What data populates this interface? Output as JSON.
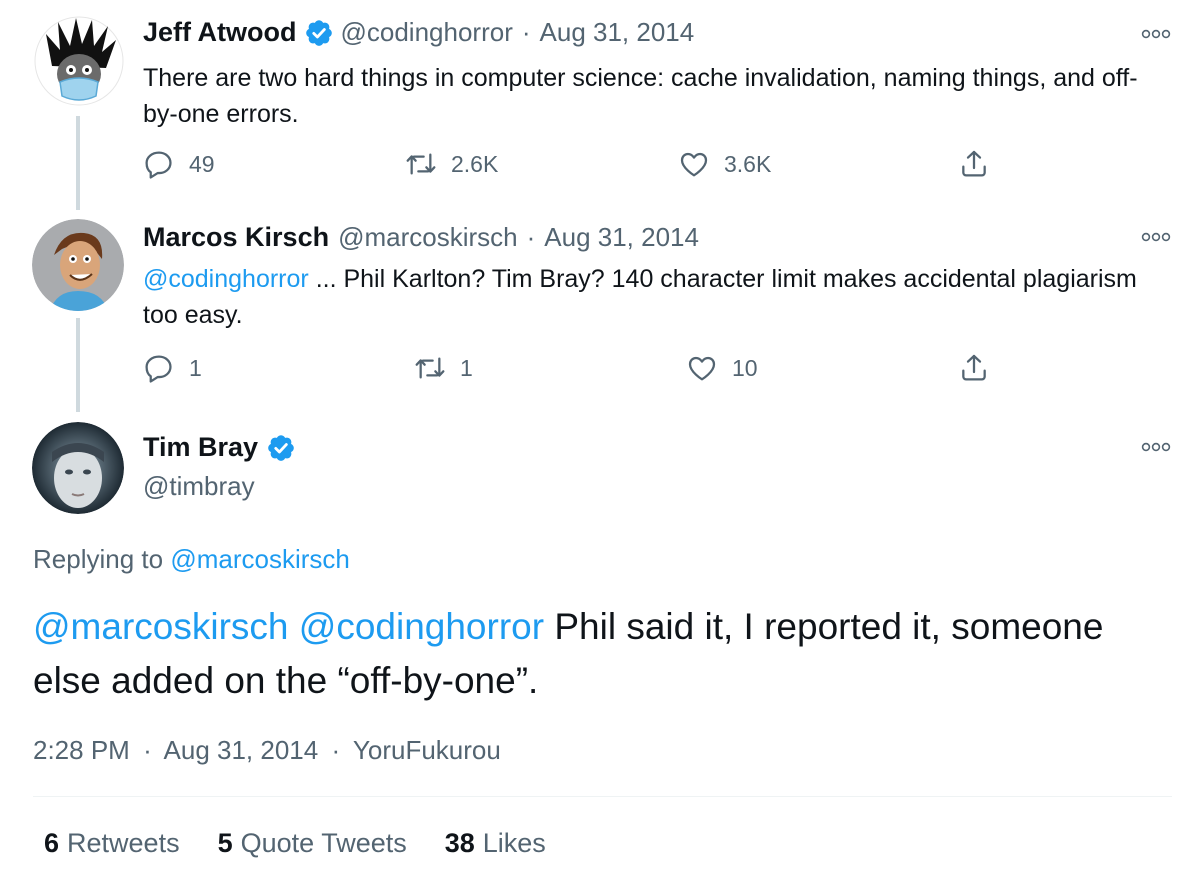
{
  "tweets": [
    {
      "author_name": "Jeff Atwood",
      "handle": "@codinghorror",
      "date": "Aug 31, 2014",
      "text": "There are two hard things in computer science: cache invalidation, naming things, and off-by-one errors.",
      "replies": "49",
      "retweets": "2.6K",
      "likes": "3.6K"
    },
    {
      "author_name": "Marcos Kirsch",
      "handle": "@marcoskirsch",
      "date": "Aug 31, 2014",
      "mention": "@codinghorror",
      "text": " ... Phil Karlton? Tim Bray? 140 character limit makes accidental plagiarism too easy.",
      "replies": "1",
      "retweets": "1",
      "likes": "10"
    }
  ],
  "main_tweet": {
    "author_name": "Tim Bray",
    "handle": "@timbray",
    "replying_to_prefix": "Replying to",
    "replying_to": "@marcoskirsch",
    "mention1": "@marcoskirsch",
    "mention2": "@codinghorror",
    "text": " Phil said it, I reported it, someone else added on the “off-by-one”.",
    "time": "2:28 PM",
    "date": "Aug 31, 2014",
    "source": "YoruFukurou",
    "stats": {
      "retweets_count": "6",
      "retweets_label": "Retweets",
      "quotes_count": "5",
      "quotes_label": "Quote Tweets",
      "likes_count": "38",
      "likes_label": "Likes"
    }
  },
  "dot": "·",
  "icons": [
    "verified-badge-icon",
    "reply-icon",
    "retweet-icon",
    "like-icon",
    "share-icon",
    "more-icon"
  ],
  "colors": {
    "accent": "#1d9bf0",
    "muted": "#536471",
    "text": "#0f1419",
    "line": "#cfd9de"
  }
}
